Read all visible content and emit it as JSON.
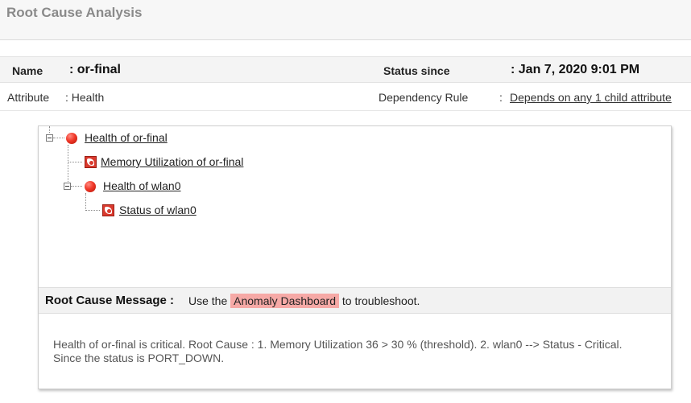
{
  "page": {
    "title": "Root Cause Analysis"
  },
  "info": {
    "name_label": "Name",
    "name_value": ": or-final",
    "status_since_label": "Status since",
    "status_since_value": ": Jan 7, 2020 9:01 PM",
    "attribute_label": "Attribute",
    "attribute_value": ": Health",
    "dependency_label": "Dependency Rule",
    "dependency_colon": ":",
    "dependency_value": "Depends on any 1 child attribute"
  },
  "tree": {
    "nodes": [
      {
        "label": "Health of or-final",
        "status": "critical",
        "icon": "red-dot-icon"
      },
      {
        "label": "Memory Utilization of or-final",
        "status": "critical",
        "icon": "critical-attribute-icon"
      },
      {
        "label": "Health of wlan0",
        "status": "critical",
        "icon": "red-dot-icon"
      },
      {
        "label": "Status of wlan0",
        "status": "critical",
        "icon": "critical-attribute-icon"
      }
    ]
  },
  "root_cause": {
    "label": "Root Cause Message :",
    "prefix": "Use the ",
    "link": "Anomaly Dashboard",
    "suffix": " to troubleshoot.",
    "detail": "Health of or-final is critical. Root Cause : 1. Memory Utilization 36 > 30 % (threshold). 2. wlan0 --> Status - Critical. Since the status is PORT_DOWN."
  },
  "colors": {
    "critical": "#f0392a",
    "highlight": "#f6a9a6",
    "title": "#8a8a8a"
  }
}
